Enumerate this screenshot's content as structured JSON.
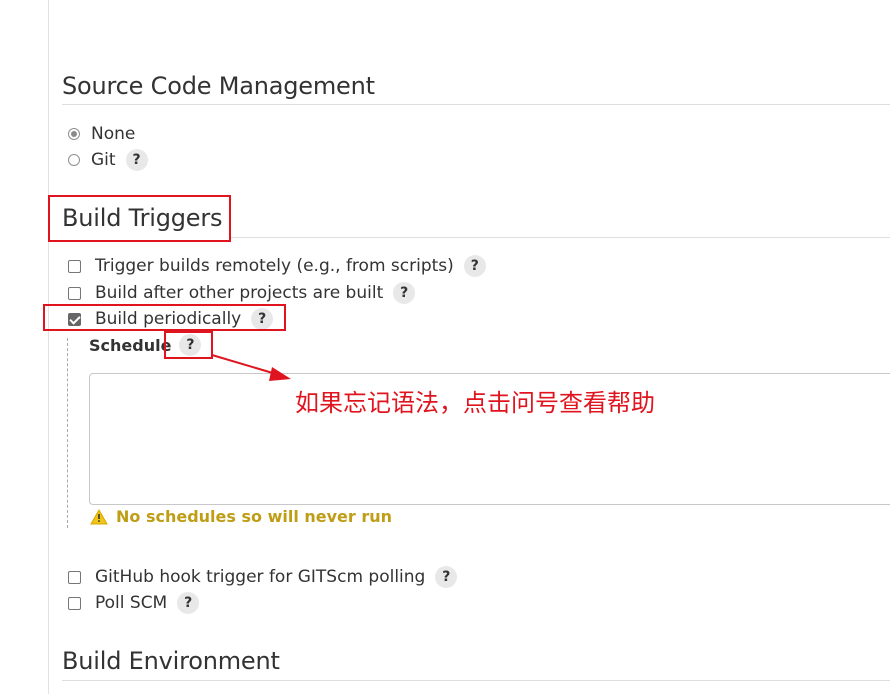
{
  "scm": {
    "title": "Source Code Management",
    "options": [
      {
        "label": "None",
        "selected": true
      },
      {
        "label": "Git",
        "selected": false,
        "help": "?"
      }
    ]
  },
  "triggers": {
    "title": "Build Triggers",
    "items": [
      {
        "label": "Trigger builds remotely (e.g., from scripts)",
        "checked": false,
        "help": "?"
      },
      {
        "label": "Build after other projects are built",
        "checked": false,
        "help": "?"
      },
      {
        "label": "Build periodically",
        "checked": true,
        "help": "?"
      }
    ],
    "schedule": {
      "label": "Schedule",
      "help": "?",
      "value": "",
      "warning": "No schedules so will never run"
    },
    "more_items": [
      {
        "label": "GitHub hook trigger for GITScm polling",
        "checked": false,
        "help": "?"
      },
      {
        "label": "Poll SCM",
        "checked": false,
        "help": "?"
      }
    ]
  },
  "environment": {
    "title": "Build Environment"
  },
  "annotation": {
    "text": "如果忘记语法，点击问号查看帮助",
    "color": "#e0141e"
  },
  "colors": {
    "warning": "#bf9e15",
    "annotation_red": "#e0141e"
  }
}
